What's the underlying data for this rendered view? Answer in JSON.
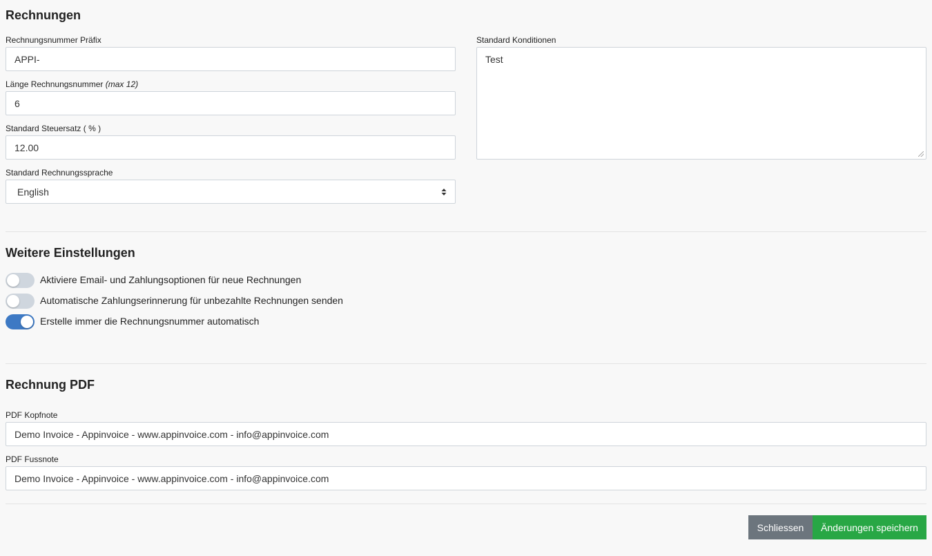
{
  "section_invoices": {
    "title": "Rechnungen",
    "prefix_label": "Rechnungsnummer Präfix",
    "prefix_value": "APPI-",
    "length_label": "Länge Rechnungsnummer",
    "length_hint": "(max 12)",
    "length_value": "6",
    "tax_label": "Standard Steuersatz ( % )",
    "tax_value": "12.00",
    "language_label": "Standard Rechnungssprache",
    "language_value": "English",
    "terms_label": "Standard Konditionen",
    "terms_value": "Test"
  },
  "section_more": {
    "title": "Weitere Einstellungen",
    "toggles": [
      {
        "label": "Aktiviere Email- und Zahlungsoptionen für neue Rechnungen",
        "checked": false
      },
      {
        "label": "Automatische Zahlungserinnerung für unbezahlte Rechnungen senden",
        "checked": false
      },
      {
        "label": "Erstelle immer die Rechnungsnummer automatisch",
        "checked": true
      }
    ]
  },
  "section_pdf": {
    "title": "Rechnung PDF",
    "header_label": "PDF Kopfnote",
    "header_value": "Demo Invoice - Appinvoice - www.appinvoice.com - info@appinvoice.com",
    "footer_label": "PDF Fussnote",
    "footer_value": "Demo Invoice - Appinvoice - www.appinvoice.com - info@appinvoice.com"
  },
  "actions": {
    "close_label": "Schliessen",
    "save_label": "Änderungen speichern"
  },
  "colors": {
    "toggle_on": "#3d79c4",
    "toggle_off": "#cfd6de",
    "close_button": "#6c757d",
    "save_button": "#28a745"
  }
}
